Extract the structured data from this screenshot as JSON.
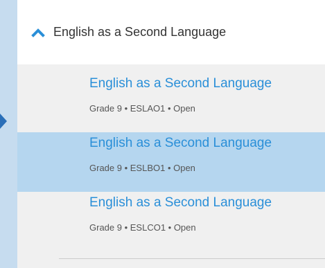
{
  "header": {
    "title": "English as a Second Language",
    "chevron_icon": "chevron-up-icon",
    "accent_color": "#2a8fd8"
  },
  "courses": [
    {
      "title": "English as a Second Language",
      "meta": "Grade 9 • ESLAO1 • Open",
      "selected": false
    },
    {
      "title": "English as a Second Language",
      "meta": "Grade 9 • ESLBO1 • Open",
      "selected": true
    },
    {
      "title": "English as a Second Language",
      "meta": "Grade 9 • ESLCO1 • Open",
      "selected": false
    }
  ],
  "colors": {
    "background": "#c6dcef",
    "selected_row": "#b5d6ef",
    "pointer_arrow": "#2a6fb8"
  }
}
